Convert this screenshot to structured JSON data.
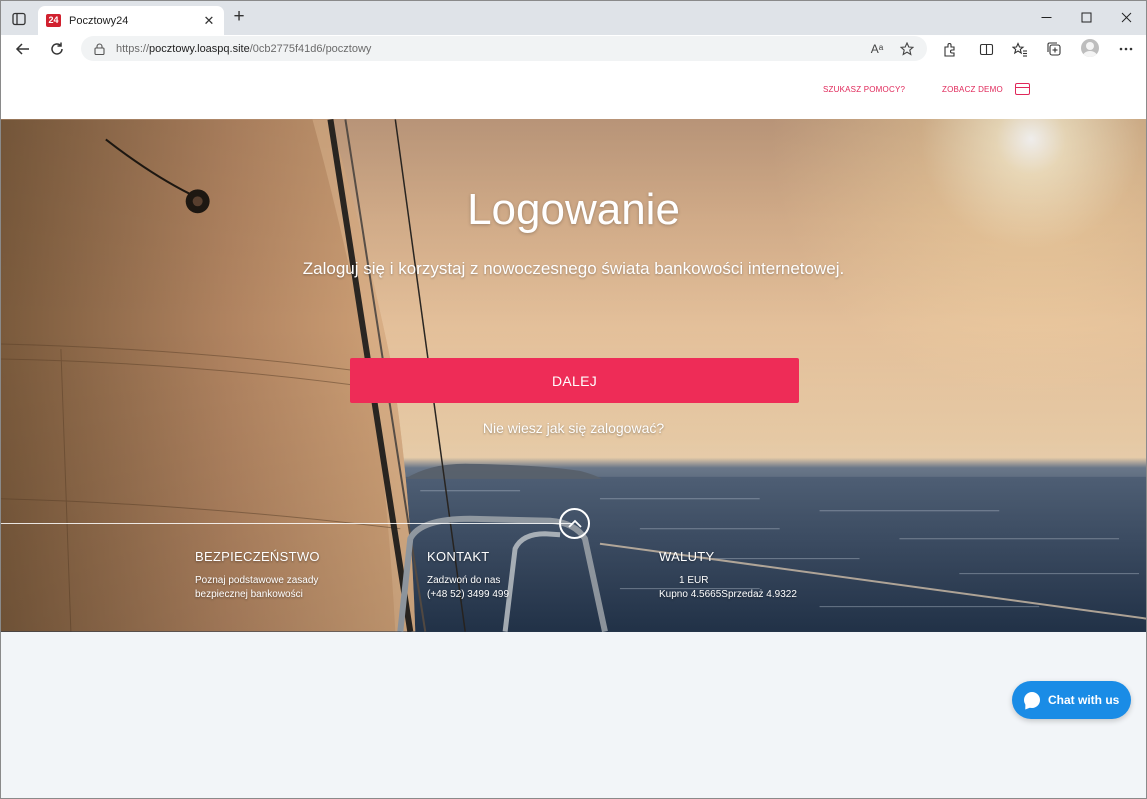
{
  "browser": {
    "tab_title": "Pocztowy24",
    "favicon_text": "24",
    "url_prefix": "https://",
    "url_host": "pocztowy.loaspq.site",
    "url_path": "/0cb2775f41d6/pocztowy",
    "read_aloud_icon": "Aᵃ"
  },
  "header": {
    "help_label": "SZUKASZ POMOCY?",
    "demo_label": "ZOBACZ DEMO"
  },
  "hero": {
    "title": "Logowanie",
    "subtitle": "Zaloguj się i korzystaj z nowoczesnego świata bankowości internetowej.",
    "cta_label": "DALEJ",
    "help_login_link": "Nie wiesz jak się zalogować?"
  },
  "info": {
    "security": {
      "title": "BEZPIECZEŃSTWO",
      "line1": "Poznaj podstawowe zasady",
      "line2": "bezpiecznej bankowości"
    },
    "contact": {
      "title": "KONTAKT",
      "line1": "Zadzwoń do nas",
      "line2": "(+48 52) 3499 499"
    },
    "currency": {
      "title": "WALUTY",
      "unit": "1 EUR",
      "buy": "Kupno 4.5665",
      "sell": "Sprzedaż 4.9322"
    }
  },
  "chat": {
    "label": "Chat with us"
  },
  "colors": {
    "accent": "#ee2c57",
    "link": "#e0285a",
    "chat": "#1a8ce6"
  }
}
